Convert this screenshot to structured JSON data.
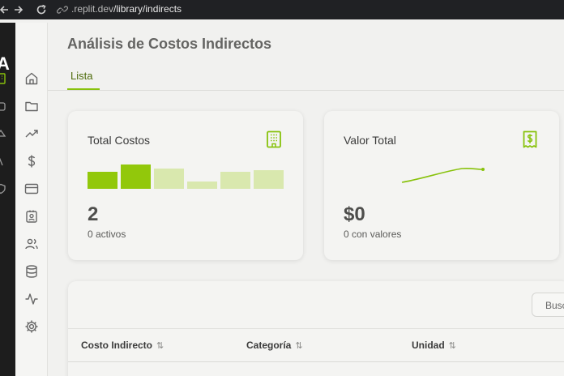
{
  "browser": {
    "url_host": ".replit.dev",
    "url_path": "/library/indirects"
  },
  "rail": {
    "letter": "A"
  },
  "page": {
    "title": "Análisis de Costos Indirectos",
    "tabs": [
      {
        "label": "Lista",
        "active": true
      }
    ]
  },
  "cards": {
    "total": {
      "label": "Total Costos",
      "value": "2",
      "sub": "0 activos",
      "bars": [
        {
          "level": 0.66,
          "strong": true
        },
        {
          "level": 0.94,
          "strong": true
        },
        {
          "level": 0.78,
          "strong": false
        },
        {
          "level": 0.28,
          "strong": false
        },
        {
          "level": 0.66,
          "strong": false
        },
        {
          "level": 0.72,
          "strong": false
        }
      ]
    },
    "valor": {
      "label": "Valor Total",
      "value": "$0",
      "sub": "0 con valores"
    }
  },
  "table": {
    "search_label": "Busc",
    "columns": [
      "Costo Indirecto",
      "Categoría",
      "Unidad"
    ],
    "sort_glyph": "⇅"
  },
  "colors": {
    "accent": "#88c20c",
    "accent_strong": "#92c80b",
    "accent_light": "#d9e8ae"
  },
  "icons": {
    "sidebar": [
      "home-icon",
      "folder-icon",
      "trending-icon",
      "dollar-icon",
      "card-icon",
      "badge-icon",
      "users-icon",
      "database-icon",
      "activity-icon",
      "settings-icon"
    ]
  }
}
